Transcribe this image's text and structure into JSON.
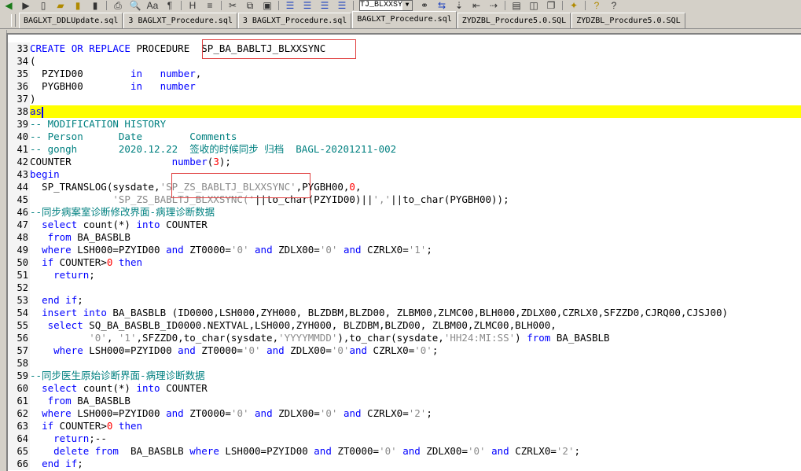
{
  "toolbar": {
    "icons": [
      "back-arrow",
      "forward-arrow",
      "new-file",
      "open-folder",
      "save-disk",
      "save-all",
      "print",
      "print-preview",
      "font",
      "format",
      "bookmark",
      "outline",
      "cut",
      "copy",
      "paste",
      "align-left",
      "align-center",
      "align-right",
      "justify",
      "binoculars",
      "find-replace",
      "goto",
      "indent",
      "replace",
      "pane-1",
      "pane-2",
      "window",
      "debug",
      "help",
      "context-help"
    ],
    "combo_value": "TJ_BLXXSYNC"
  },
  "tabs": [
    {
      "label": "BAGLXT_DDLUpdate.sql",
      "active": false
    },
    {
      "label": "3 BAGLXT_Procedure.sql",
      "active": false
    },
    {
      "label": "3 BAGLXT_Procedure.sql",
      "active": false
    },
    {
      "label": "BAGLXT_Procedure.sql",
      "active": true
    },
    {
      "label": "ZYDZBL_Procdure5.0.SQL",
      "active": false
    },
    {
      "label": "ZYDZBL_Procdure5.0.SQL",
      "active": false
    }
  ],
  "colors": {
    "keyword": "#0000ff",
    "comment": "#008080",
    "string": "#8a8a8a",
    "number": "#ff0000",
    "highlight": "#ffff00"
  },
  "lines": [
    {
      "n": "33",
      "t": [
        [
          "k",
          "CREATE"
        ],
        [
          "p",
          " "
        ],
        [
          "k",
          "OR"
        ],
        [
          "p",
          " "
        ],
        [
          "k",
          "REPLACE"
        ],
        [
          "p",
          " PROCEDURE  SP_BA_BABLTJ_BLXXSYNC"
        ]
      ]
    },
    {
      "n": "34",
      "t": [
        [
          "p",
          "("
        ]
      ]
    },
    {
      "n": "35",
      "t": [
        [
          "p",
          "  PZYID00        "
        ],
        [
          "k",
          "in"
        ],
        [
          "p",
          "   "
        ],
        [
          "k",
          "number"
        ],
        [
          "p",
          ","
        ]
      ]
    },
    {
      "n": "36",
      "t": [
        [
          "p",
          "  PYGBH00        "
        ],
        [
          "k",
          "in"
        ],
        [
          "p",
          "   "
        ],
        [
          "k",
          "number"
        ]
      ]
    },
    {
      "n": "37",
      "t": [
        [
          "p",
          ")"
        ]
      ]
    },
    {
      "n": "38",
      "hl": true,
      "t": [
        [
          "k",
          "as"
        ]
      ]
    },
    {
      "n": "39",
      "t": [
        [
          "c",
          "-- MODIFICATION HISTORY"
        ]
      ]
    },
    {
      "n": "40",
      "t": [
        [
          "c",
          "-- Person      Date        Comments"
        ]
      ]
    },
    {
      "n": "41",
      "t": [
        [
          "c",
          "-- gongh       2020.12.22  签收的时候同步 归档  BAGL-20201211-002"
        ]
      ]
    },
    {
      "n": "42",
      "t": [
        [
          "p",
          "COUNTER                 "
        ],
        [
          "k",
          "number"
        ],
        [
          "p",
          "("
        ],
        [
          "n",
          "3"
        ],
        [
          "p",
          ");"
        ]
      ]
    },
    {
      "n": "43",
      "t": [
        [
          "k",
          "begin"
        ]
      ]
    },
    {
      "n": "44",
      "t": [
        [
          "p",
          "  SP_TRANSLOG(sysdate,"
        ],
        [
          "s",
          "'SP_ZS_BABLTJ_BLXXSYNC'"
        ],
        [
          "p",
          ",PYGBH00,"
        ],
        [
          "n",
          "0"
        ],
        [
          "p",
          ","
        ]
      ]
    },
    {
      "n": "45",
      "t": [
        [
          "p",
          "              "
        ],
        [
          "s",
          "'SP_ZS_BABLTJ_BLXXSYNC('"
        ],
        [
          "p",
          "||to_char(PZYID00)||"
        ],
        [
          "s",
          "','"
        ],
        [
          "p",
          "||to_char(PYGBH00));"
        ]
      ]
    },
    {
      "n": "46",
      "t": [
        [
          "c",
          "--同步病案室诊断修改界面-病理诊断数据"
        ]
      ]
    },
    {
      "n": "47",
      "t": [
        [
          "p",
          "  "
        ],
        [
          "k",
          "select"
        ],
        [
          "p",
          " count(*) "
        ],
        [
          "k",
          "into"
        ],
        [
          "p",
          " COUNTER"
        ]
      ]
    },
    {
      "n": "48",
      "t": [
        [
          "p",
          "   "
        ],
        [
          "k",
          "from"
        ],
        [
          "p",
          " BA_BASBLB"
        ]
      ]
    },
    {
      "n": "49",
      "t": [
        [
          "p",
          "  "
        ],
        [
          "k",
          "where"
        ],
        [
          "p",
          " LSH000=PZYID00 "
        ],
        [
          "k",
          "and"
        ],
        [
          "p",
          " ZT0000="
        ],
        [
          "s",
          "'0'"
        ],
        [
          "p",
          " "
        ],
        [
          "k",
          "and"
        ],
        [
          "p",
          " ZDLX00="
        ],
        [
          "s",
          "'0'"
        ],
        [
          "p",
          " "
        ],
        [
          "k",
          "and"
        ],
        [
          "p",
          " CZRLX0="
        ],
        [
          "s",
          "'1'"
        ],
        [
          "p",
          ";"
        ]
      ]
    },
    {
      "n": "50",
      "t": [
        [
          "p",
          "  "
        ],
        [
          "k",
          "if"
        ],
        [
          "p",
          " COUNTER>"
        ],
        [
          "n",
          "0"
        ],
        [
          "p",
          " "
        ],
        [
          "k",
          "then"
        ]
      ]
    },
    {
      "n": "51",
      "t": [
        [
          "p",
          "    "
        ],
        [
          "k",
          "return"
        ],
        [
          "p",
          ";"
        ]
      ]
    },
    {
      "n": "52",
      "t": []
    },
    {
      "n": "53",
      "t": [
        [
          "p",
          "  "
        ],
        [
          "k",
          "end if"
        ],
        [
          "p",
          ";"
        ]
      ]
    },
    {
      "n": "54",
      "t": [
        [
          "p",
          "  "
        ],
        [
          "k",
          "insert into"
        ],
        [
          "p",
          " BA_BASBLB (ID0000,LSH000,ZYH000, BLZDBM,BLZD00, ZLBM00,ZLMC00,BLH000,ZDLX00,CZRLX0,SFZZD0,CJRQ00,CJSJ00)"
        ]
      ]
    },
    {
      "n": "55",
      "t": [
        [
          "p",
          "   "
        ],
        [
          "k",
          "select"
        ],
        [
          "p",
          " SQ_BA_BASBLB_ID0000.NEXTVAL,LSH000,ZYH000, BLZDBM,BLZD00, ZLBM00,ZLMC00,BLH000,"
        ]
      ]
    },
    {
      "n": "56",
      "t": [
        [
          "p",
          "          "
        ],
        [
          "s",
          "'0'"
        ],
        [
          "p",
          ", "
        ],
        [
          "s",
          "'1'"
        ],
        [
          "p",
          ",SFZZD0,to_char(sysdate,"
        ],
        [
          "s",
          "'YYYYMMDD'"
        ],
        [
          "p",
          "),to_char(sysdate,"
        ],
        [
          "s",
          "'HH24:MI:SS'"
        ],
        [
          "p",
          ") "
        ],
        [
          "k",
          "from"
        ],
        [
          "p",
          " BA_BASBLB"
        ]
      ]
    },
    {
      "n": "57",
      "t": [
        [
          "p",
          "    "
        ],
        [
          "k",
          "where"
        ],
        [
          "p",
          " LSH000=PZYID00 "
        ],
        [
          "k",
          "and"
        ],
        [
          "p",
          " ZT0000="
        ],
        [
          "s",
          "'0'"
        ],
        [
          "p",
          " "
        ],
        [
          "k",
          "and"
        ],
        [
          "p",
          " ZDLX00="
        ],
        [
          "s",
          "'0'"
        ],
        [
          "k",
          "and"
        ],
        [
          "p",
          " CZRLX0="
        ],
        [
          "s",
          "'0'"
        ],
        [
          "p",
          ";"
        ]
      ]
    },
    {
      "n": "58",
      "t": []
    },
    {
      "n": "59",
      "t": [
        [
          "c",
          "--同步医生原始诊断界面-病理诊断数据"
        ]
      ]
    },
    {
      "n": "60",
      "t": [
        [
          "p",
          "  "
        ],
        [
          "k",
          "select"
        ],
        [
          "p",
          " count(*) "
        ],
        [
          "k",
          "into"
        ],
        [
          "p",
          " COUNTER"
        ]
      ]
    },
    {
      "n": "61",
      "t": [
        [
          "p",
          "   "
        ],
        [
          "k",
          "from"
        ],
        [
          "p",
          " BA_BASBLB"
        ]
      ]
    },
    {
      "n": "62",
      "t": [
        [
          "p",
          "  "
        ],
        [
          "k",
          "where"
        ],
        [
          "p",
          " LSH000=PZYID00 "
        ],
        [
          "k",
          "and"
        ],
        [
          "p",
          " ZT0000="
        ],
        [
          "s",
          "'0'"
        ],
        [
          "p",
          " "
        ],
        [
          "k",
          "and"
        ],
        [
          "p",
          " ZDLX00="
        ],
        [
          "s",
          "'0'"
        ],
        [
          "p",
          " "
        ],
        [
          "k",
          "and"
        ],
        [
          "p",
          " CZRLX0="
        ],
        [
          "s",
          "'2'"
        ],
        [
          "p",
          ";"
        ]
      ]
    },
    {
      "n": "63",
      "t": [
        [
          "p",
          "  "
        ],
        [
          "k",
          "if"
        ],
        [
          "p",
          " COUNTER>"
        ],
        [
          "n",
          "0"
        ],
        [
          "p",
          " "
        ],
        [
          "k",
          "then"
        ]
      ]
    },
    {
      "n": "64",
      "t": [
        [
          "p",
          "    "
        ],
        [
          "k",
          "return"
        ],
        [
          "p",
          ";--"
        ]
      ]
    },
    {
      "n": "65",
      "t": [
        [
          "p",
          "    "
        ],
        [
          "k",
          "delete from"
        ],
        [
          "p",
          "  BA_BASBLB "
        ],
        [
          "k",
          "where"
        ],
        [
          "p",
          " LSH000=PZYID00 "
        ],
        [
          "k",
          "and"
        ],
        [
          "p",
          " ZT0000="
        ],
        [
          "s",
          "'0'"
        ],
        [
          "p",
          " "
        ],
        [
          "k",
          "and"
        ],
        [
          "p",
          " ZDLX00="
        ],
        [
          "s",
          "'0'"
        ],
        [
          "p",
          " "
        ],
        [
          "k",
          "and"
        ],
        [
          "p",
          " CZRLX0="
        ],
        [
          "s",
          "'2'"
        ],
        [
          "p",
          ";"
        ]
      ]
    },
    {
      "n": "66",
      "t": [
        [
          "p",
          "  "
        ],
        [
          "k",
          "end if"
        ],
        [
          "p",
          ";"
        ]
      ]
    }
  ]
}
